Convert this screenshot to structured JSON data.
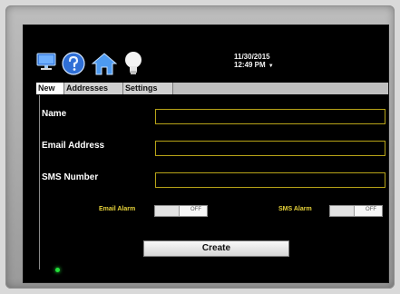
{
  "header": {
    "date": "11/30/2015",
    "time": "12:49 PM",
    "time_caret": "▼",
    "icons": [
      "monitor-icon",
      "help-icon",
      "home-icon",
      "lightbulb-icon"
    ]
  },
  "tabs": [
    {
      "label": "New",
      "active": true
    },
    {
      "label": "Addresses",
      "active": false
    },
    {
      "label": "Settings",
      "active": false
    }
  ],
  "form": {
    "name_label": "Name",
    "email_label": "Email Address",
    "sms_label": "SMS Number",
    "name_value": "",
    "email_value": "",
    "sms_value": ""
  },
  "alarms": {
    "email_label": "Email Alarm",
    "email_state": "OFF",
    "sms_label": "SMS Alarm",
    "sms_state": "OFF"
  },
  "create_label": "Create",
  "colors": {
    "field_border": "#b7a318",
    "alarm_label": "#e6d23a",
    "status_led": "#22e03a"
  }
}
